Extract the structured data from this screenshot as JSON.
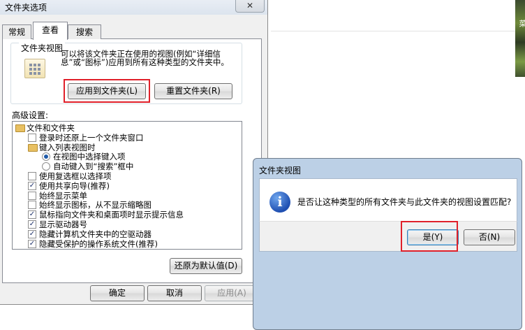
{
  "folder_options": {
    "title": "文件夹选项",
    "close_glyph": "✕",
    "tabs": [
      "常规",
      "查看",
      "搜索"
    ],
    "folder_views": {
      "label": "文件夹视图",
      "description": "可以将该文件夹正在使用的视图(例如“详细信息”或“图标”)应用到所有这种类型的文件夹中。",
      "apply_button": "应用到文件夹(L)",
      "reset_button": "重置文件夹(R)"
    },
    "advanced": {
      "label": "高级设置:",
      "items": [
        {
          "type": "folder",
          "text": "文件和文件夹"
        },
        {
          "type": "checkbox",
          "checked": false,
          "text": "登录时还原上一个文件夹窗口"
        },
        {
          "type": "folder",
          "text": "键入列表视图时"
        },
        {
          "type": "radio",
          "checked": true,
          "text": "在视图中选择键入项"
        },
        {
          "type": "radio",
          "checked": false,
          "text": "自动键入到“搜索”框中"
        },
        {
          "type": "checkbox",
          "checked": false,
          "text": "使用复选框以选择项"
        },
        {
          "type": "checkbox",
          "checked": true,
          "text": "使用共享向导(推荐)"
        },
        {
          "type": "checkbox",
          "checked": false,
          "text": "始终显示菜单"
        },
        {
          "type": "checkbox",
          "checked": false,
          "text": "始终显示图标，从不显示缩略图"
        },
        {
          "type": "checkbox",
          "checked": true,
          "text": "鼠标指向文件夹和桌面项时显示提示信息"
        },
        {
          "type": "checkbox",
          "checked": true,
          "text": "显示驱动器号"
        },
        {
          "type": "checkbox",
          "checked": true,
          "text": "隐藏计算机文件夹中的空驱动器"
        },
        {
          "type": "checkbox",
          "checked": true,
          "text": "隐藏受保护的操作系统文件(推荐)"
        }
      ],
      "restore_button": "还原为默认值(D)"
    },
    "footer": {
      "ok": "确定",
      "cancel": "取消",
      "apply": "应用(A)"
    }
  },
  "confirm_dialog": {
    "title": "文件夹视图",
    "message": "是否让这种类型的所有文件夹与此文件夹的视图设置匹配?",
    "icon": "info-icon",
    "yes": "是(Y)",
    "no": "否(N)"
  },
  "background_app": {
    "strip_text": "菜"
  },
  "colors": {
    "highlight": "#e0202a",
    "accent": "#1f5aa8"
  }
}
